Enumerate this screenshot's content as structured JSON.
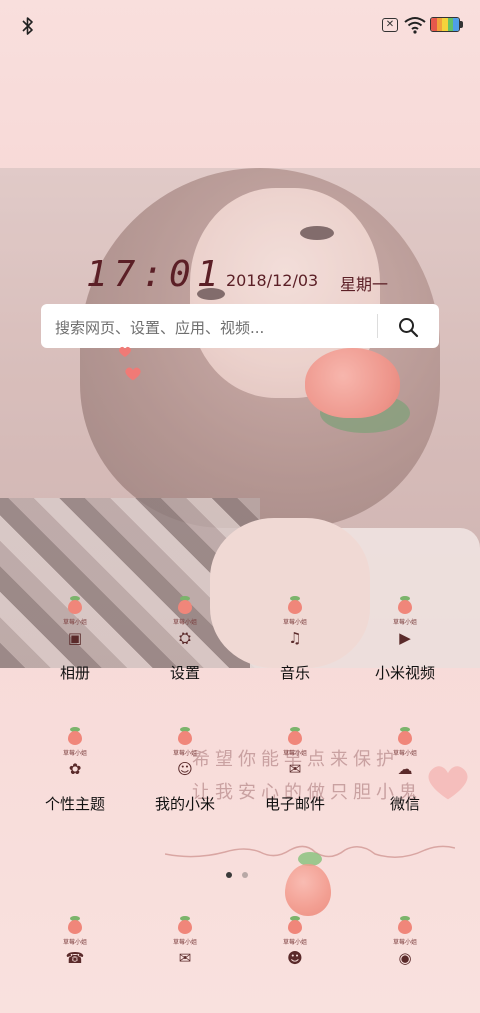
{
  "status_bar": {
    "left_icon": "bluetooth-icon",
    "right_icons": [
      "no-sim-icon",
      "wifi-icon",
      "battery-icon"
    ],
    "no_sim_glyph": "✕",
    "battery_colors": [
      "#e6584c",
      "#f2a23c",
      "#f3d33c",
      "#64c168",
      "#4f9ee8"
    ]
  },
  "clock": {
    "time": "17:01",
    "date": "2018/12/03",
    "weekday": "星期一"
  },
  "search": {
    "placeholder": "搜索网页、设置、应用、视频..."
  },
  "theme_tag": "草莓小姐",
  "apps_row1": [
    {
      "label": "相册",
      "glyph": "▣"
    },
    {
      "label": "设置",
      "glyph": "⛭"
    },
    {
      "label": "音乐",
      "glyph": "♫"
    },
    {
      "label": "小米视频",
      "glyph": "▶"
    }
  ],
  "apps_row2": [
    {
      "label": "个性主题",
      "glyph": "✿"
    },
    {
      "label": "我的小米",
      "glyph": "☺"
    },
    {
      "label": "电子邮件",
      "glyph": "✉"
    },
    {
      "label": "微信",
      "glyph": "☁"
    }
  ],
  "dock": [
    {
      "glyph": "☎"
    },
    {
      "glyph": "✉"
    },
    {
      "glyph": "☻"
    },
    {
      "glyph": "◉"
    }
  ],
  "wallpaper_text": {
    "line1": "希望你能早点来保护",
    "line2": "让我安心的做只胆小鬼"
  },
  "page_indicator": {
    "total": 2,
    "active": 0,
    "active_color": "#3a3a3a",
    "inactive_color": "#b8a8a6"
  },
  "colors": {
    "clock_text": "#5b1f26",
    "heart": "#f07a76"
  }
}
